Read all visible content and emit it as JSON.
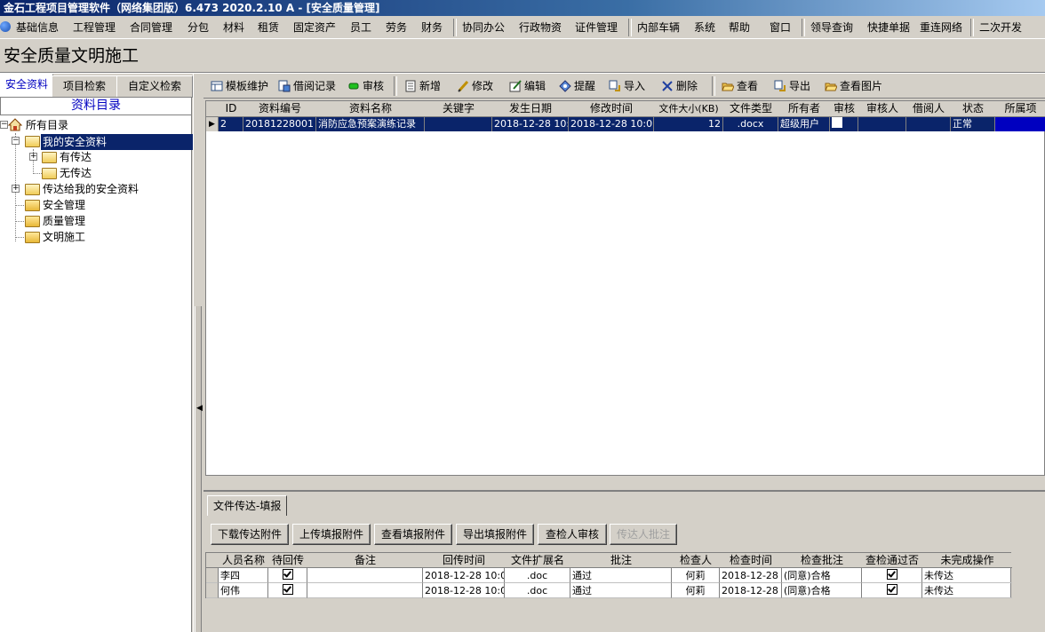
{
  "window": {
    "title": "金石工程项目管理软件（网络集团版）6.473  2020.2.10 A - [安全质量管理]"
  },
  "menu": [
    "基础信息",
    "工程管理",
    "合同管理",
    "分包",
    "材料",
    "租赁",
    "固定资产",
    "员工",
    "劳务",
    "财务",
    "协同办公",
    "行政物资",
    "证件管理",
    "内部车辆",
    "系统",
    "帮助",
    "窗口",
    "领导查询",
    "快捷单据",
    "重连网络",
    "二次开发"
  ],
  "module_title": "安全质量文明施工",
  "left_tabs": [
    "安全资料",
    "项目检索",
    "自定义检索"
  ],
  "tree": {
    "header": "资料目录",
    "nodes": [
      "所有目录",
      "我的安全资料",
      "有传达",
      "无传达",
      "传达给我的安全资料",
      "安全管理",
      "质量管理",
      "文明施工"
    ]
  },
  "toolbar": [
    "模板维护",
    "借阅记录",
    "审核",
    "新增",
    "修改",
    "编辑",
    "提醒",
    "导入",
    "删除",
    "查看",
    "导出",
    "查看图片"
  ],
  "grid": {
    "columns": [
      "ID",
      "资料编号",
      "资料名称",
      "关键字",
      "发生日期",
      "修改时间",
      "文件大小(KB)",
      "文件类型",
      "所有者",
      "审核",
      "审核人",
      "借阅人",
      "状态",
      "所属项"
    ],
    "rows": [
      {
        "id": "2",
        "code": "20181228001",
        "name": "消防应急预案演练记录",
        "keyword": "",
        "date": "2018-12-28 10:",
        "modified": "2018-12-28 10:0",
        "size": "12",
        "type": ".docx",
        "owner": "超级用户",
        "audit": "",
        "auditor": "",
        "borrower": "",
        "status": "正常",
        "project": ""
      }
    ]
  },
  "bottom_tab": "文件传达-填报",
  "bottom_buttons": [
    "下载传达附件",
    "上传填报附件",
    "查看填报附件",
    "导出填报附件",
    "查检人审核",
    "传达人批注"
  ],
  "subgrid": {
    "columns": [
      "人员名称",
      "待回传",
      "备注",
      "回传时间",
      "文件扩展名",
      "批注",
      "检查人",
      "检查时间",
      "检查批注",
      "查检通过否",
      "未完成操作"
    ],
    "rows": [
      {
        "name": "李四",
        "pending": true,
        "note": "",
        "return_time": "2018-12-28 10:0",
        "ext": ".doc",
        "remark": "通过",
        "checker": "何莉",
        "check_time": "2018-12-28",
        "check_note": "(同意)合格",
        "passed": true,
        "todo": "未传达"
      },
      {
        "name": "何伟",
        "pending": true,
        "note": "",
        "return_time": "2018-12-28 10:0",
        "ext": ".doc",
        "remark": "通过",
        "checker": "何莉",
        "check_time": "2018-12-28",
        "check_note": "(同意)合格",
        "passed": true,
        "todo": "未传达"
      }
    ]
  }
}
